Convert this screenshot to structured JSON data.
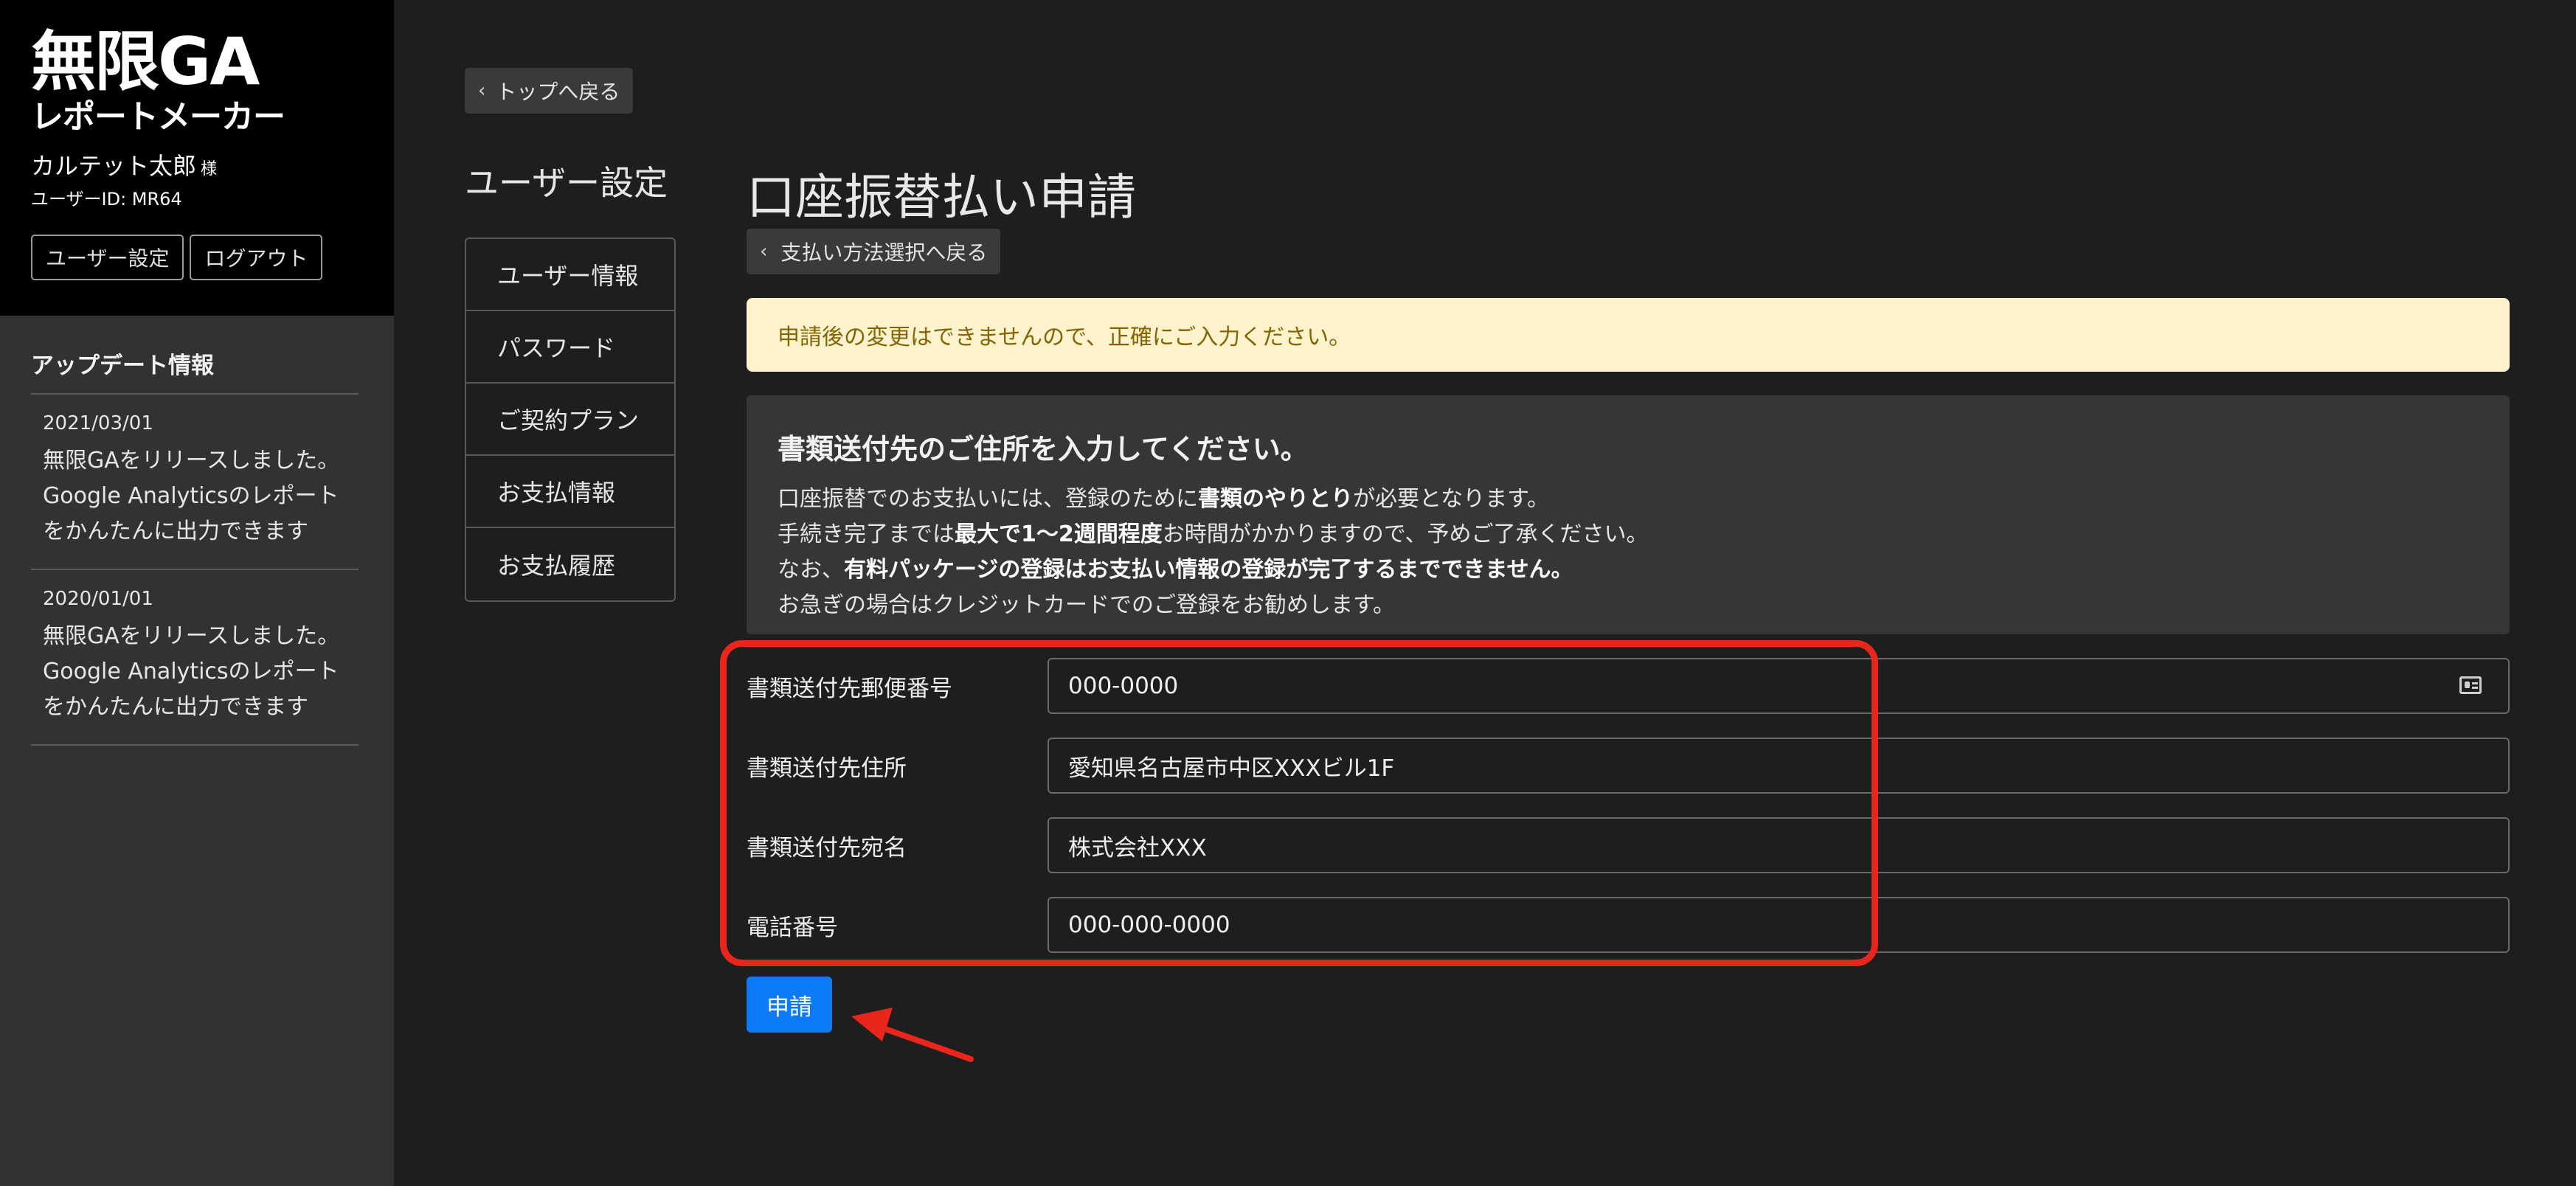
{
  "brand": {
    "logo_line1": "無限GA",
    "logo_line2": "レポートメーカー"
  },
  "user": {
    "name": "カルテット太郎",
    "honorific": "様",
    "id_text": "ユーザーID: MR64"
  },
  "sidebar_buttons": {
    "settings_label": "ユーザー設定",
    "logout_label": "ログアウト"
  },
  "updates": {
    "title": "アップデート情報",
    "items": [
      {
        "date": "2021/03/01",
        "text": "無限GAをリリースしました。Google Analyticsのレポートをかんたんに出力できます"
      },
      {
        "date": "2020/01/01",
        "text": "無限GAをリリースしました。Google Analyticsのレポートをかんたんに出力できます"
      }
    ]
  },
  "back_to_top_label": "トップへ戻る",
  "settings": {
    "title": "ユーザー設定",
    "nav": [
      "ユーザー情報",
      "パスワード",
      "ご契約プラン",
      "お支払情報",
      "お支払履歴"
    ]
  },
  "main": {
    "title": "口座振替払い申請",
    "back_label": "支払い方法選択へ戻る",
    "alert": "申請後の変更はできませんので、正確にご入力ください。",
    "info": {
      "heading": "書類送付先のご住所を入力してください。",
      "line1_pre": "口座振替でのお支払いには、登録のために",
      "line1_bold": "書類のやりとり",
      "line1_post": "が必要となります。",
      "line2_pre": "手続き完了までは",
      "line2_bold": "最大で1〜2週間程度",
      "line2_post": "お時間がかかりますので、予めご了承ください。",
      "line3_pre": "なお、",
      "line3_bold": "有料パッケージの登録はお支払い情報の登録が完了するまでできません。",
      "line4": "お急ぎの場合はクレジットカードでのご登録をお勧めします。"
    },
    "form": {
      "postal": {
        "label": "書類送付先郵便番号",
        "value": "000-0000"
      },
      "address": {
        "label": "書類送付先住所",
        "value": "愛知県名古屋市中区XXXビル1F"
      },
      "recipient": {
        "label": "書類送付先宛名",
        "value": "株式会社XXX"
      },
      "phone": {
        "label": "電話番号",
        "value": "000-000-0000"
      }
    },
    "submit_label": "申請"
  },
  "colors": {
    "primary": "#0d7bf7",
    "alert_bg": "#fff3cd",
    "alert_text": "#856404",
    "annotation": "#e8261c"
  }
}
